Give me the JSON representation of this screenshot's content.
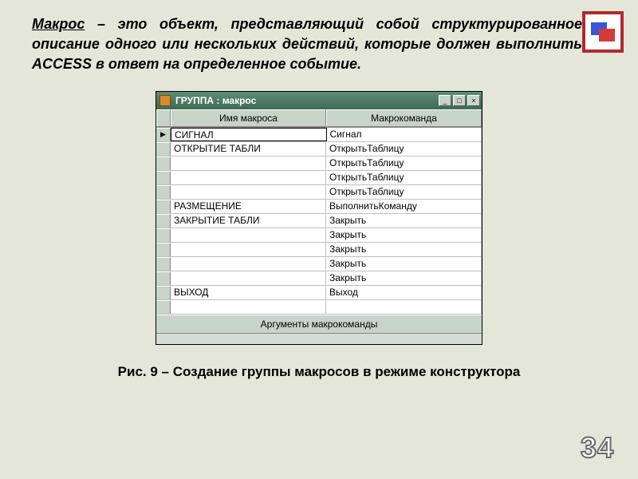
{
  "definition": {
    "term": "Макрос",
    "rest": " – это объект, представляющий собой структурированное описание одного или нескольких действий, которые должен выполнить ACCESS в ответ на определенное событие."
  },
  "window": {
    "title": "ГРУППА : макрос",
    "columns": {
      "name": "Имя макроса",
      "command": "Макрокоманда"
    },
    "buttons": {
      "min": "_",
      "max": "□",
      "close": "×"
    },
    "rows": [
      {
        "selected": true,
        "name": "СИГНАЛ",
        "cmd": "Сигнал",
        "editing": true
      },
      {
        "selected": false,
        "name": "ОТКРЫТИЕ ТАБЛИ",
        "cmd": "ОткрытьТаблицу"
      },
      {
        "selected": false,
        "name": "",
        "cmd": "ОткрытьТаблицу"
      },
      {
        "selected": false,
        "name": "",
        "cmd": "ОткрытьТаблицу"
      },
      {
        "selected": false,
        "name": "",
        "cmd": "ОткрытьТаблицу"
      },
      {
        "selected": false,
        "name": "РАЗМЕЩЕНИЕ",
        "cmd": "ВыполнитьКоманду"
      },
      {
        "selected": false,
        "name": "ЗАКРЫТИЕ ТАБЛИ",
        "cmd": "Закрыть"
      },
      {
        "selected": false,
        "name": "",
        "cmd": "Закрыть"
      },
      {
        "selected": false,
        "name": "",
        "cmd": "Закрыть"
      },
      {
        "selected": false,
        "name": "",
        "cmd": "Закрыть"
      },
      {
        "selected": false,
        "name": "",
        "cmd": "Закрыть"
      },
      {
        "selected": false,
        "name": "ВЫХОД",
        "cmd": "Выход"
      },
      {
        "selected": false,
        "name": "",
        "cmd": ""
      }
    ],
    "args_header": "Аргументы макрокоманды"
  },
  "caption": "Рис. 9 – Создание группы макросов в режиме конструктора",
  "page_number": "34"
}
